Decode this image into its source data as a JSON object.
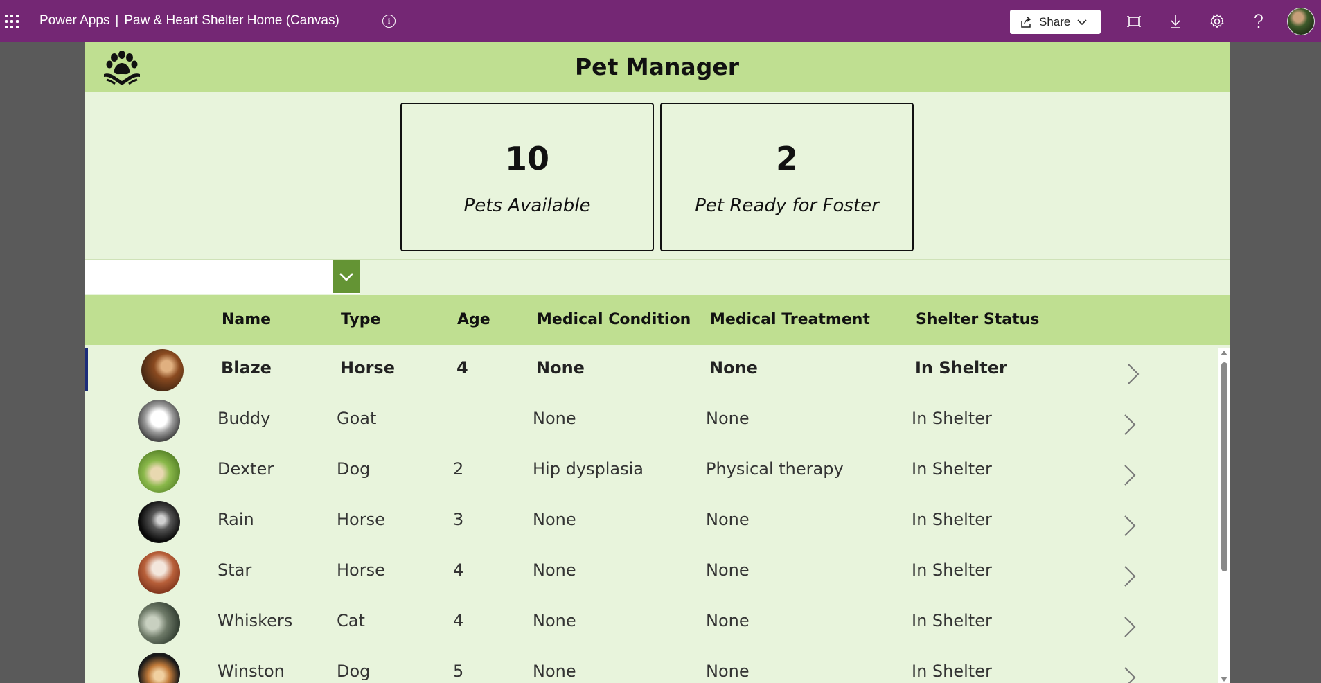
{
  "topbar": {
    "app_name": "Power Apps",
    "separator": "|",
    "app_title": "Paw & Heart Shelter Home (Canvas)",
    "share_label": "Share",
    "icons": [
      "waffle-icon",
      "info-icon",
      "share-icon",
      "chevron-down-icon",
      "fit-screen-icon",
      "download-icon",
      "settings-icon",
      "help-icon",
      "user-avatar"
    ]
  },
  "header": {
    "title": "Pet Manager"
  },
  "stats": [
    {
      "value": "10",
      "label": "Pets Available"
    },
    {
      "value": "2",
      "label": "Pet Ready for Foster"
    }
  ],
  "filter": {
    "value": ""
  },
  "table": {
    "columns": [
      "Name",
      "Type",
      "Age",
      "Medical Condition",
      "Medical Treatment",
      "Shelter Status"
    ],
    "rows": [
      {
        "name": "Blaze",
        "type": "Horse",
        "age": "4",
        "condition": "None",
        "treatment": "None",
        "status": "In Shelter"
      },
      {
        "name": "Buddy",
        "type": "Goat",
        "age": "",
        "condition": "None",
        "treatment": "None",
        "status": "In Shelter"
      },
      {
        "name": "Dexter",
        "type": "Dog",
        "age": "2",
        "condition": "Hip dysplasia",
        "treatment": "Physical therapy",
        "status": "In Shelter"
      },
      {
        "name": "Rain",
        "type": "Horse",
        "age": "3",
        "condition": "None",
        "treatment": "None",
        "status": "In Shelter"
      },
      {
        "name": "Star",
        "type": "Horse",
        "age": "4",
        "condition": "None",
        "treatment": "None",
        "status": "In Shelter"
      },
      {
        "name": "Whiskers",
        "type": "Cat",
        "age": "4",
        "condition": "None",
        "treatment": "None",
        "status": "In Shelter"
      },
      {
        "name": "Winston",
        "type": "Dog",
        "age": "5",
        "condition": "None",
        "treatment": "None",
        "status": "In Shelter"
      }
    ]
  },
  "colors": {
    "topbar": "#742774",
    "header_green": "#bfdf91",
    "canvas_green": "#e8f4dc",
    "dropdown_button": "#649434",
    "selected_row_marker": "#1c2d7a"
  }
}
